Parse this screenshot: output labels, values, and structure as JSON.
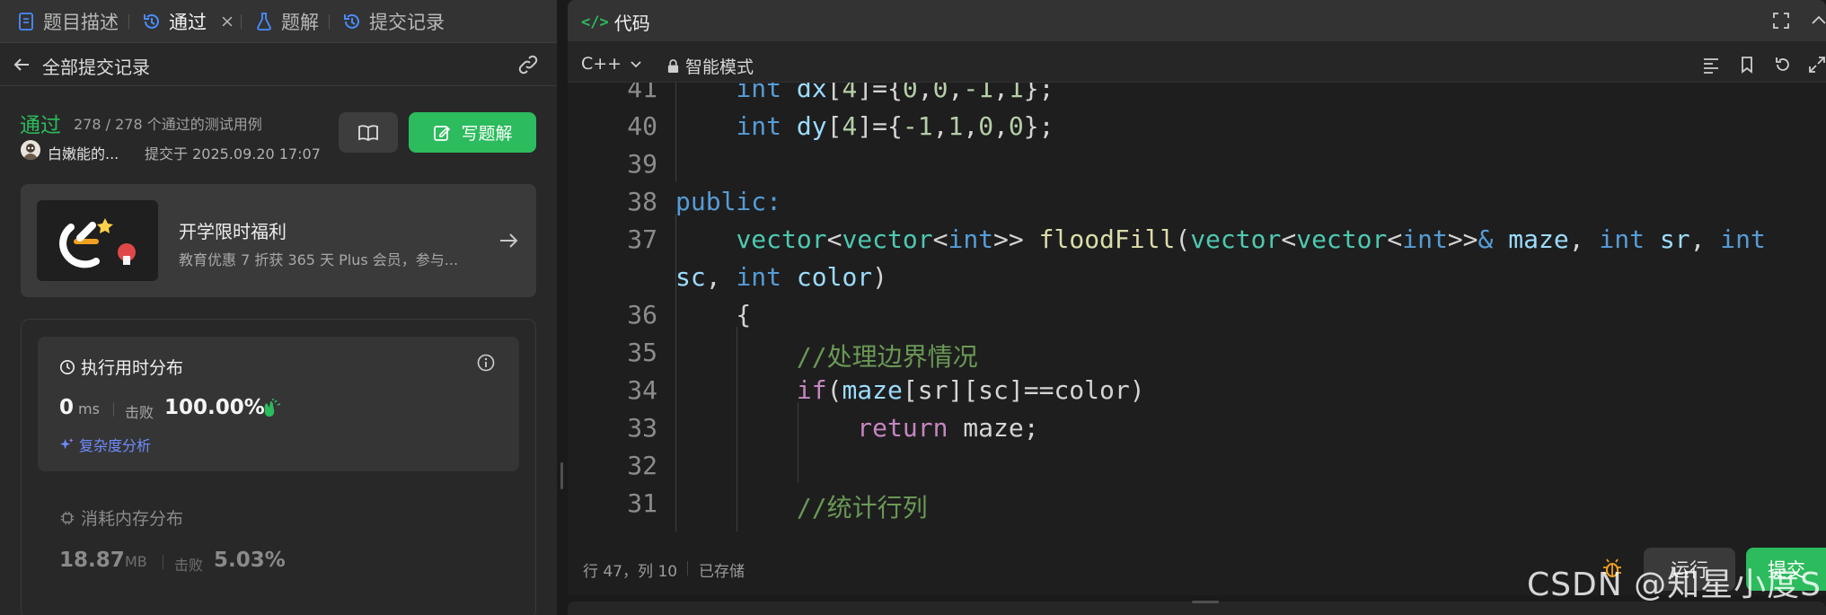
{
  "left_tabs": [
    {
      "label": "题目描述"
    },
    {
      "label": "通过"
    },
    {
      "label": "题解"
    },
    {
      "label": "提交记录"
    }
  ],
  "subheader": {
    "back_label": "全部提交记录"
  },
  "submission": {
    "status": "通过",
    "test_count": "278 / 278 个通过的测试用例",
    "username": "白嫩能的...",
    "submit_time": "提交于 2025.09.20 17:07",
    "write_solution_label": "写题解"
  },
  "promo": {
    "title": "开学限时福利",
    "description": "教育优惠 7 折获 365 天 Plus 会员，参与..."
  },
  "runtime": {
    "title": "执行用时分布",
    "value": "0",
    "unit": "ms",
    "beat_label": "击败",
    "beat_value": "100.00%",
    "complexity_label": "复杂度分析"
  },
  "memory": {
    "title": "消耗内存分布",
    "value": "18.87",
    "unit": "MB",
    "beat_label": "击败",
    "beat_value": "5.03%"
  },
  "code_panel": {
    "title": "代码",
    "language": "C++",
    "mode": "智能模式",
    "line_numbers": [
      "41",
      "40",
      "39",
      "38",
      "37",
      "",
      "36",
      "35",
      "34",
      "33",
      "32",
      "31"
    ]
  },
  "statusbar": {
    "position": "行 47，列 10",
    "saved": "已存储",
    "run_label": "运行",
    "submit_label": "提交"
  },
  "watermark": "CSDN @知星小度S",
  "colors": {
    "accent_green": "#2cbb5d",
    "complexity_blue": "#6e8cff"
  }
}
